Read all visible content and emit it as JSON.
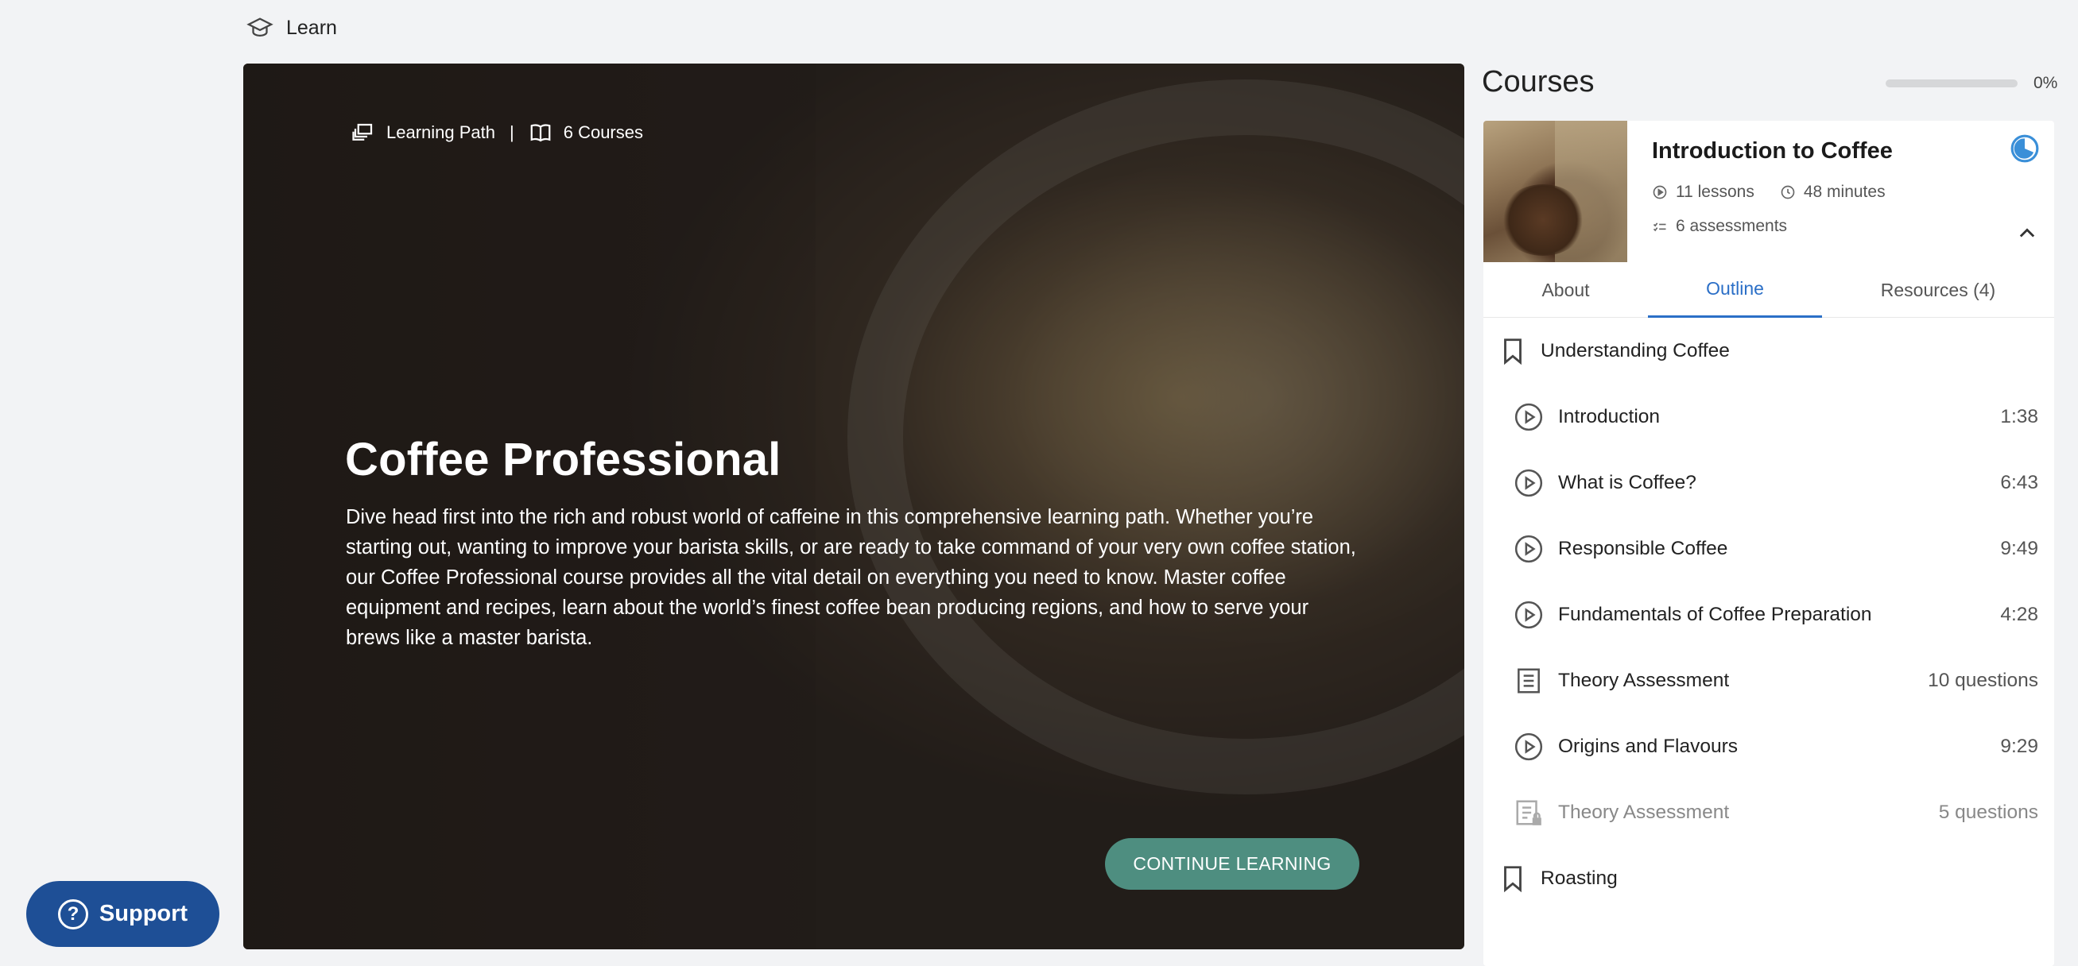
{
  "topbar": {
    "title": "Learn",
    "icon": "graduation-cap-icon"
  },
  "hero": {
    "meta_type": "Learning Path",
    "meta_separator": "|",
    "meta_courses": "6 Courses",
    "title": "Coffee Professional",
    "description": "Dive head first into the rich and robust world of caffeine in this comprehensive learning path. Whether you’re starting out, wanting to improve your barista skills, or are ready to take command of your very own coffee station, our Coffee Professional course provides all the vital detail on everything you need to know. Master coffee equipment and recipes, learn about the world’s finest coffee bean producing regions, and how to serve your brews like a master barista.",
    "cta_label": "CONTINUE LEARNING"
  },
  "support": {
    "label": "Support",
    "glyph": "?"
  },
  "sidebar": {
    "title": "Courses",
    "progress_label": "0%",
    "progress_value": 0,
    "course": {
      "title": "Introduction to Coffee",
      "lessons": "11 lessons",
      "duration": "48 minutes",
      "assessments": "6 assessments"
    },
    "tabs": [
      "About",
      "Outline",
      "Resources (4)"
    ],
    "active_tab": "Outline",
    "outline": [
      {
        "type": "section",
        "label": "Understanding Coffee",
        "value": "",
        "icon": "bookmark-icon"
      },
      {
        "type": "lesson",
        "label": "Introduction",
        "value": "1:38",
        "icon": "play-circle-icon"
      },
      {
        "type": "lesson",
        "label": "What is Coffee?",
        "value": "6:43",
        "icon": "play-circle-icon"
      },
      {
        "type": "lesson",
        "label": "Responsible Coffee",
        "value": "9:49",
        "icon": "play-circle-icon"
      },
      {
        "type": "lesson",
        "label": "Fundamentals of Coffee Preparation",
        "value": "4:28",
        "icon": "play-circle-icon"
      },
      {
        "type": "assessment",
        "label": "Theory Assessment",
        "value": "10 questions",
        "icon": "document-icon"
      },
      {
        "type": "lesson",
        "label": "Origins and Flavours",
        "value": "9:29",
        "icon": "play-circle-icon"
      },
      {
        "type": "assessment-locked",
        "label": "Theory Assessment",
        "value": "5 questions",
        "icon": "locked-document-icon"
      },
      {
        "type": "section",
        "label": "Roasting",
        "value": "",
        "icon": "bookmark-icon"
      }
    ]
  },
  "colors": {
    "accent": "#2b6fc7",
    "cta": "#4e8e80",
    "support": "#1e4f96"
  }
}
